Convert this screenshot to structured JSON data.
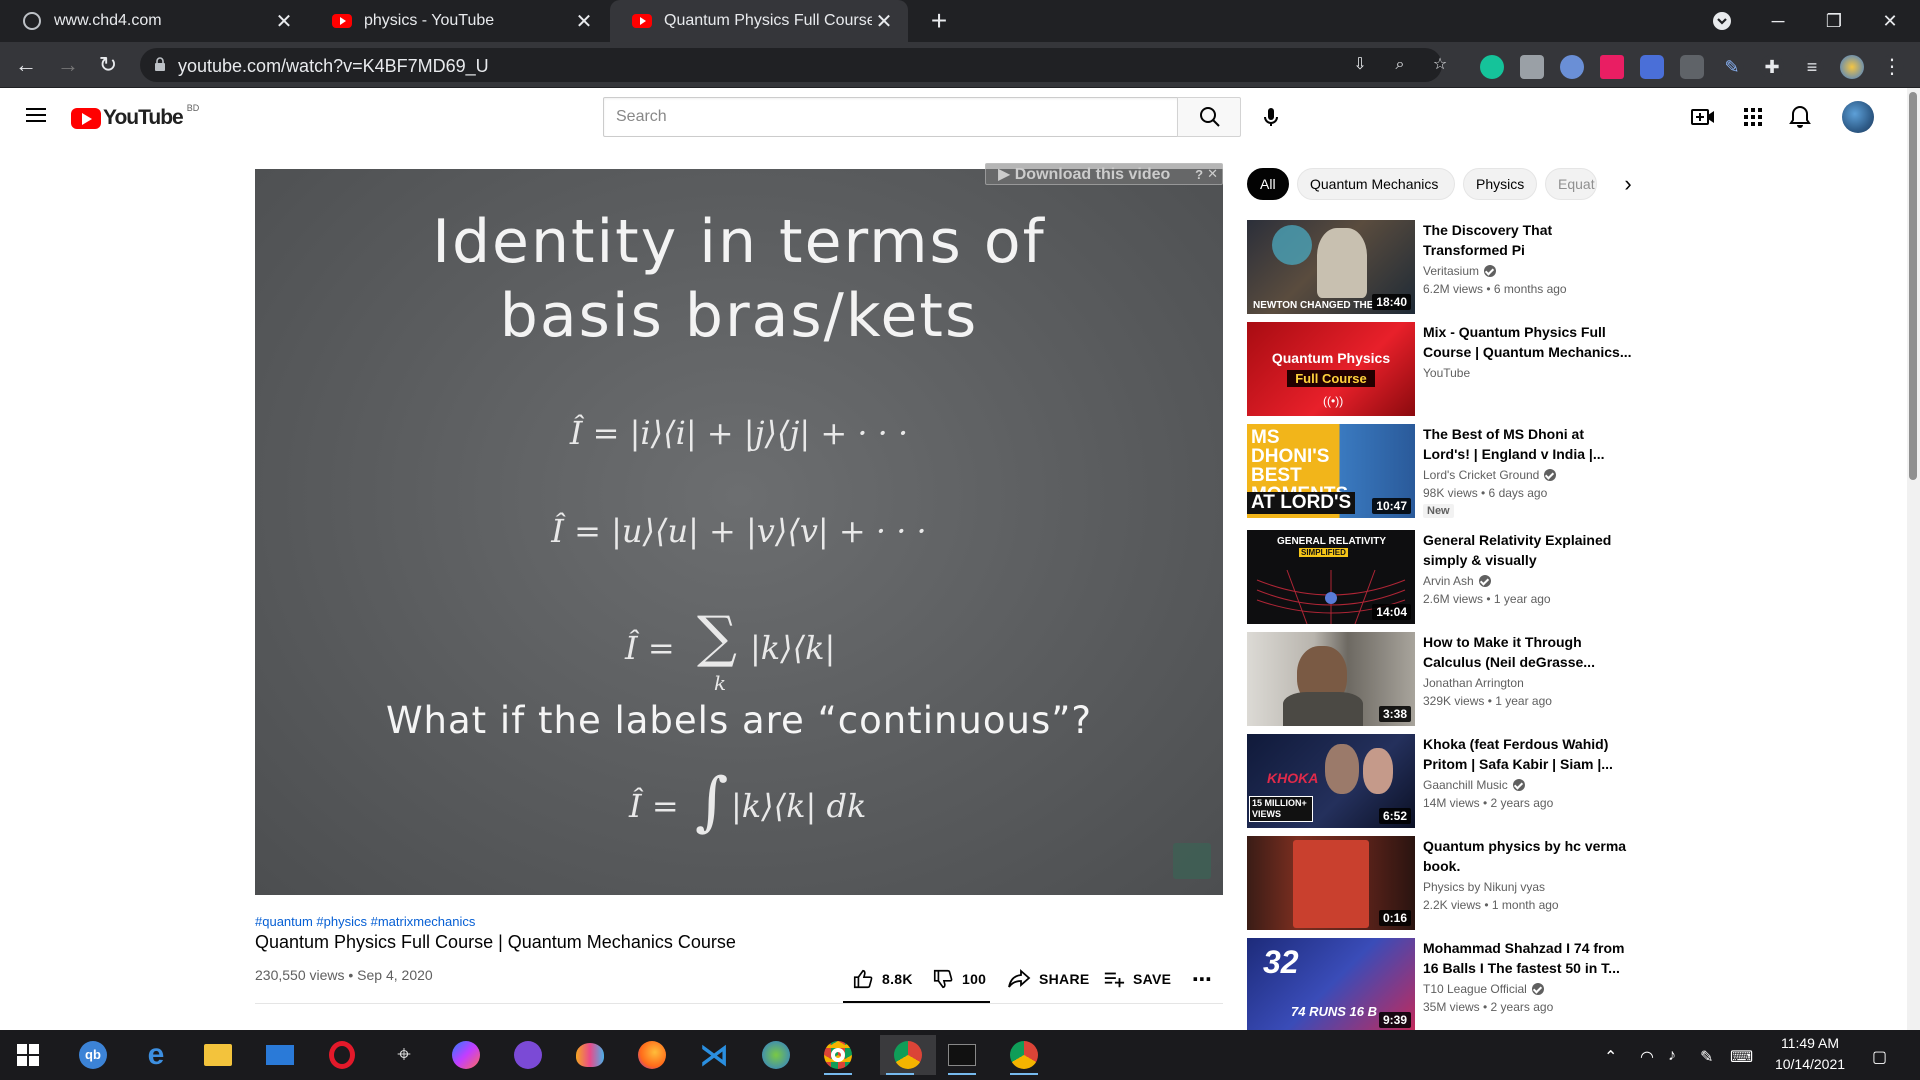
{
  "browser": {
    "tabs": [
      {
        "title": "www.chd4.com",
        "icon": "globe-icon"
      },
      {
        "title": "physics - YouTube",
        "icon": "youtube-icon"
      },
      {
        "title": "Quantum Physics Full Course | Qu",
        "icon": "youtube-icon",
        "active": true
      }
    ],
    "url": "youtube.com/watch?v=K4BF7MD69_U"
  },
  "youtube": {
    "logo_text": "YouTube",
    "country_code": "BD",
    "search_placeholder": "Search"
  },
  "video": {
    "board_title_line1": "Identity in terms of",
    "board_title_line2": "basis bras/kets",
    "eq1": "Î = |i⟩⟨i| + |j⟩⟨j| + · · ·",
    "eq2": "Î = |u⟩⟨u| + |v⟩⟨v| + · · ·",
    "eq3_lhs": "Î =",
    "eq3_sum": "∑",
    "eq3_sub": "k",
    "eq3_rhs": "|k⟩⟨k|",
    "question": "What if the labels are “continuous”?",
    "eq4_lhs": "Î =",
    "eq4_int": "∫",
    "eq4_rhs": "|k⟩⟨k| dk",
    "download_overlay": "▶ Download this video",
    "hashtags": "#quantum #physics #matrixmechanics",
    "title": "Quantum Physics Full Course | Quantum Mechanics Course",
    "meta": "230,550 views • Sep 4, 2020",
    "likes": "8.8K",
    "dislikes": "100",
    "share": "SHARE",
    "save": "SAVE"
  },
  "chips": [
    "All",
    "Quantum Mechanics",
    "Physics",
    "Equat"
  ],
  "recommendations": [
    {
      "title": "The Discovery That Transformed Pi",
      "channel": "Veritasium",
      "verified": true,
      "views": "6.2M views • 6 months ago",
      "duration": "18:40",
      "thumb_text": "NEWTON CHANGED THE"
    },
    {
      "title": "Mix - Quantum Physics Full Course | Quantum Mechanics...",
      "channel": "YouTube",
      "verified": false,
      "views": "",
      "duration": "",
      "thumb_text": "Quantum Physics",
      "thumb_text2": "Full Course"
    },
    {
      "title": "The Best of MS Dhoni at Lord's! | England v India |...",
      "channel": "Lord's Cricket Ground",
      "verified": true,
      "views": "98K views • 6 days ago",
      "duration": "10:47",
      "badge": "New",
      "thumb_text": "MS DHONI'S BEST MOMENTS",
      "thumb_text2": "AT LORD'S"
    },
    {
      "title": "General Relativity Explained simply & visually",
      "channel": "Arvin Ash",
      "verified": true,
      "views": "2.6M views • 1 year ago",
      "duration": "14:04",
      "thumb_text": "GENERAL RELATIVITY",
      "thumb_text2": "SIMPLIFIED"
    },
    {
      "title": "How to Make it Through Calculus (Neil deGrasse...",
      "channel": "Jonathan Arrington",
      "verified": false,
      "views": "329K views • 1 year ago",
      "duration": "3:38"
    },
    {
      "title": "Khoka (feat Ferdous Wahid) Pritom | Safa Kabir | Siam |...",
      "channel": "Gaanchill Music",
      "verified": true,
      "views": "14M views • 2 years ago",
      "duration": "6:52",
      "thumb_text": "KHOKA",
      "thumb_text2": "15 MILLION+ VIEWS"
    },
    {
      "title": "Quantum physics by hc verma book.",
      "channel": "Physics by Nikunj vyas",
      "verified": false,
      "views": "2.2K views • 1 month ago",
      "duration": "0:16"
    },
    {
      "title": "Mohammad Shahzad I 74 from 16 Balls I The fastest 50 in T...",
      "channel": "T10 League Official",
      "verified": true,
      "views": "35M views • 2 years ago",
      "duration": "9:39",
      "thumb_text": "32",
      "thumb_text2": "74 RUNS 16 B"
    }
  ],
  "taskbar": {
    "time": "11:49 AM",
    "date": "10/14/2021"
  },
  "colors": {
    "youtube_red": "#ff0000",
    "chrome_dark": "#202124",
    "link_blue": "#065fd4"
  }
}
